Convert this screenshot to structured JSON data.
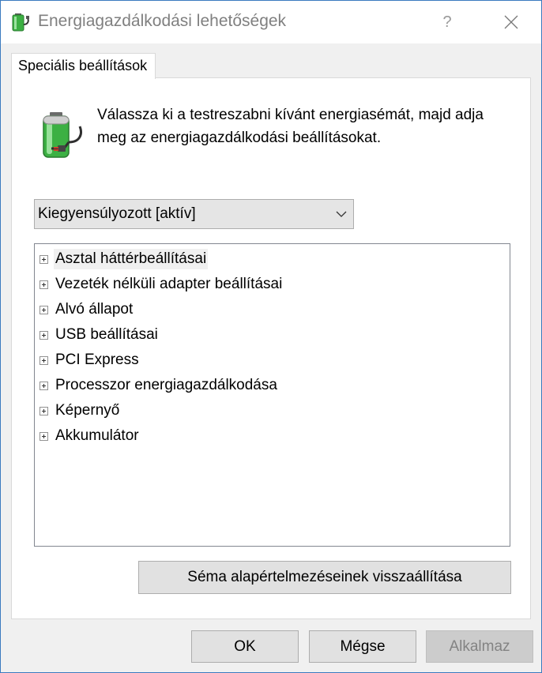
{
  "window": {
    "title": "Energiagazdálkodási lehetőségek",
    "help_label": "?"
  },
  "tab": {
    "label": "Speciális beállítások"
  },
  "description": "Válassza ki a testreszabni kívánt energiasémát, majd adja meg az energiagazdálkodási beállításokat.",
  "plan_select": {
    "value": "Kiegyensúlyozott [aktív]"
  },
  "tree": {
    "items": [
      {
        "label": "Asztal háttérbeállításai",
        "selected": true
      },
      {
        "label": "Vezeték nélküli adapter beállításai"
      },
      {
        "label": "Alvó állapot"
      },
      {
        "label": "USB beállításai"
      },
      {
        "label": "PCI Express"
      },
      {
        "label": "Processzor energiagazdálkodása"
      },
      {
        "label": "Képernyő"
      },
      {
        "label": "Akkumulátor"
      }
    ]
  },
  "reset_button": {
    "label": "Séma alapértelmezéseinek visszaállítása"
  },
  "footer": {
    "ok_label": "OK",
    "cancel_label": "Mégse",
    "apply_label": "Alkalmaz",
    "apply_disabled": true
  },
  "colors": {
    "window_border": "#3b7bbf",
    "battery_green": "#3cb043",
    "disabled_text": "#838383"
  }
}
